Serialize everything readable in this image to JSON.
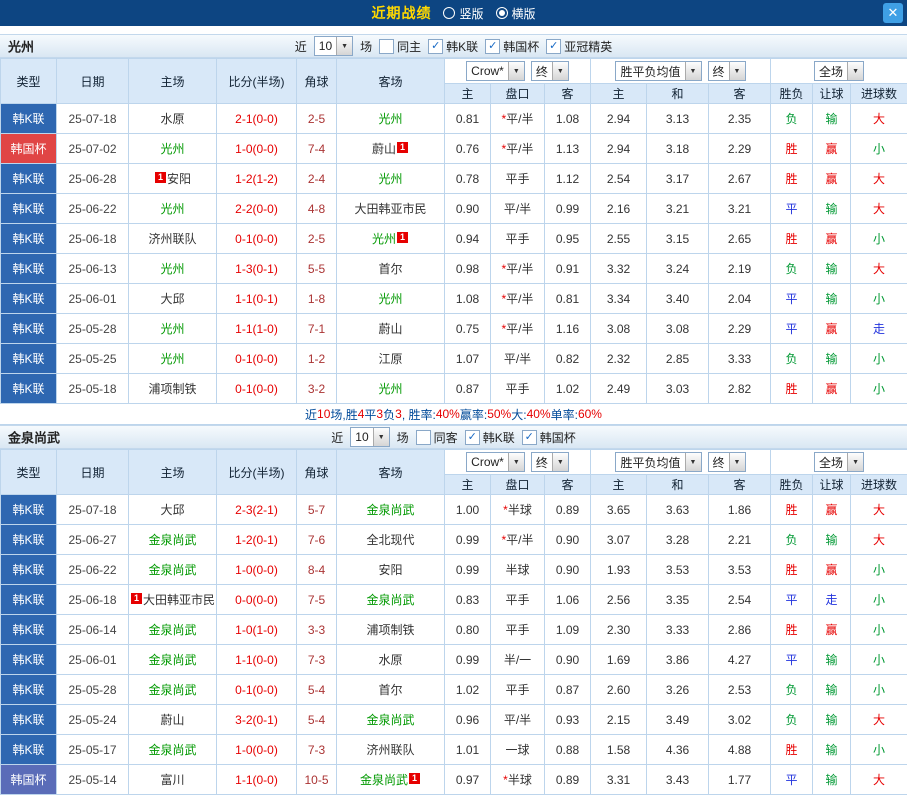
{
  "topbar": {
    "title": "近期战绩",
    "layout_options": [
      {
        "label": "竖版",
        "selected": false
      },
      {
        "label": "横版",
        "selected": true
      }
    ],
    "close_label": "✕"
  },
  "table": {
    "headers": {
      "left": [
        "类型",
        "日期",
        "主场",
        "比分(半场)",
        "角球",
        "客场"
      ],
      "odds_select": "Crow*",
      "odds_stage_select": "终",
      "avg_select": "胜平负均值",
      "avg_stage_select": "终",
      "scope_select": "全场",
      "odds_sub": [
        "主",
        "盘口",
        "客"
      ],
      "avg_sub": [
        "主",
        "和",
        "客"
      ],
      "result_sub": [
        "胜负",
        "让球",
        "进球数"
      ]
    }
  },
  "colors": {
    "topbar_bg": "#0d4582",
    "title": "#ffd800",
    "close_bg": "#3fa0e6",
    "header_bg": "#d8e8f8",
    "grid_border": "#bdd5ec",
    "team_green": "#009900",
    "score_red": "#e60000",
    "corner": "#aa3333",
    "summary_base": "#004a99",
    "summary_red": "#e60000",
    "handicap_star": "#e60000",
    "type_palette": {
      "league_blue": "#2e67b1",
      "cup_red": "#e04545",
      "cup_indigo": "#5a6cb8"
    },
    "outcome": {
      "red": "#e60000",
      "green": "#009933",
      "blue": "#2233dd"
    }
  },
  "sections": [
    {
      "team": "光州",
      "filter": {
        "near_label": "近",
        "count": "10",
        "games_label": "场",
        "same": {
          "label": "同主",
          "checked": false
        },
        "leagues": [
          {
            "label": "韩K联",
            "checked": true
          },
          {
            "label": "韩国杯",
            "checked": true
          },
          {
            "label": "亚冠精英",
            "checked": true
          }
        ]
      },
      "rows": [
        {
          "type": "韩K联",
          "type_style": "league_blue",
          "date": "25-07-18",
          "home": {
            "n": "水原",
            "hl": false
          },
          "score": "2-1(0-0)",
          "corner": "2-5",
          "away": {
            "n": "光州",
            "hl": true
          },
          "odds": [
            "0.81",
            "*平/半",
            "1.08"
          ],
          "avg": [
            "2.94",
            "3.13",
            "2.35"
          ],
          "result": [
            {
              "t": "负",
              "c": "green"
            },
            {
              "t": "输",
              "c": "green"
            },
            {
              "t": "大",
              "c": "red"
            }
          ]
        },
        {
          "type": "韩国杯",
          "type_style": "cup_red",
          "date": "25-07-02",
          "home": {
            "n": "光州",
            "hl": true
          },
          "score": "1-0(0-0)",
          "corner": "7-4",
          "away": {
            "n": "蔚山",
            "hl": false,
            "badge": "1",
            "badge_side": "right"
          },
          "odds": [
            "0.76",
            "*平/半",
            "1.13"
          ],
          "avg": [
            "2.94",
            "3.18",
            "2.29"
          ],
          "result": [
            {
              "t": "胜",
              "c": "red"
            },
            {
              "t": "赢",
              "c": "red"
            },
            {
              "t": "小",
              "c": "green"
            }
          ]
        },
        {
          "type": "韩K联",
          "type_style": "league_blue",
          "date": "25-06-28",
          "home": {
            "n": "安阳",
            "hl": false,
            "badge": "1",
            "badge_side": "left"
          },
          "score": "1-2(1-2)",
          "corner": "2-4",
          "away": {
            "n": "光州",
            "hl": true
          },
          "odds": [
            "0.78",
            "平手",
            "1.12"
          ],
          "avg": [
            "2.54",
            "3.17",
            "2.67"
          ],
          "result": [
            {
              "t": "胜",
              "c": "red"
            },
            {
              "t": "赢",
              "c": "red"
            },
            {
              "t": "大",
              "c": "red"
            }
          ]
        },
        {
          "type": "韩K联",
          "type_style": "league_blue",
          "date": "25-06-22",
          "home": {
            "n": "光州",
            "hl": true
          },
          "score": "2-2(0-0)",
          "corner": "4-8",
          "away": {
            "n": "大田韩亚市民",
            "hl": false
          },
          "odds": [
            "0.90",
            "平/半",
            "0.99"
          ],
          "avg": [
            "2.16",
            "3.21",
            "3.21"
          ],
          "result": [
            {
              "t": "平",
              "c": "blue"
            },
            {
              "t": "输",
              "c": "green"
            },
            {
              "t": "大",
              "c": "red"
            }
          ]
        },
        {
          "type": "韩K联",
          "type_style": "league_blue",
          "date": "25-06-18",
          "home": {
            "n": "济州联队",
            "hl": false
          },
          "score": "0-1(0-0)",
          "corner": "2-5",
          "away": {
            "n": "光州",
            "hl": true,
            "badge": "1",
            "badge_side": "right"
          },
          "odds": [
            "0.94",
            "平手",
            "0.95"
          ],
          "avg": [
            "2.55",
            "3.15",
            "2.65"
          ],
          "result": [
            {
              "t": "胜",
              "c": "red"
            },
            {
              "t": "赢",
              "c": "red"
            },
            {
              "t": "小",
              "c": "green"
            }
          ]
        },
        {
          "type": "韩K联",
          "type_style": "league_blue",
          "date": "25-06-13",
          "home": {
            "n": "光州",
            "hl": true
          },
          "score": "1-3(0-1)",
          "corner": "5-5",
          "away": {
            "n": "首尔",
            "hl": false
          },
          "odds": [
            "0.98",
            "*平/半",
            "0.91"
          ],
          "avg": [
            "3.32",
            "3.24",
            "2.19"
          ],
          "result": [
            {
              "t": "负",
              "c": "green"
            },
            {
              "t": "输",
              "c": "green"
            },
            {
              "t": "大",
              "c": "red"
            }
          ]
        },
        {
          "type": "韩K联",
          "type_style": "league_blue",
          "date": "25-06-01",
          "home": {
            "n": "大邱",
            "hl": false
          },
          "score": "1-1(0-1)",
          "corner": "1-8",
          "away": {
            "n": "光州",
            "hl": true
          },
          "odds": [
            "1.08",
            "*平/半",
            "0.81"
          ],
          "avg": [
            "3.34",
            "3.40",
            "2.04"
          ],
          "result": [
            {
              "t": "平",
              "c": "blue"
            },
            {
              "t": "输",
              "c": "green"
            },
            {
              "t": "小",
              "c": "green"
            }
          ]
        },
        {
          "type": "韩K联",
          "type_style": "league_blue",
          "date": "25-05-28",
          "home": {
            "n": "光州",
            "hl": true
          },
          "score": "1-1(1-0)",
          "corner": "7-1",
          "away": {
            "n": "蔚山",
            "hl": false
          },
          "odds": [
            "0.75",
            "*平/半",
            "1.16"
          ],
          "avg": [
            "3.08",
            "3.08",
            "2.29"
          ],
          "result": [
            {
              "t": "平",
              "c": "blue"
            },
            {
              "t": "赢",
              "c": "red"
            },
            {
              "t": "走",
              "c": "blue"
            }
          ]
        },
        {
          "type": "韩K联",
          "type_style": "league_blue",
          "date": "25-05-25",
          "home": {
            "n": "光州",
            "hl": true
          },
          "score": "0-1(0-0)",
          "corner": "1-2",
          "away": {
            "n": "江原",
            "hl": false
          },
          "odds": [
            "1.07",
            "平/半",
            "0.82"
          ],
          "avg": [
            "2.32",
            "2.85",
            "3.33"
          ],
          "result": [
            {
              "t": "负",
              "c": "green"
            },
            {
              "t": "输",
              "c": "green"
            },
            {
              "t": "小",
              "c": "green"
            }
          ]
        },
        {
          "type": "韩K联",
          "type_style": "league_blue",
          "date": "25-05-18",
          "home": {
            "n": "浦项制铁",
            "hl": false
          },
          "score": "0-1(0-0)",
          "corner": "3-2",
          "away": {
            "n": "光州",
            "hl": true
          },
          "odds": [
            "0.87",
            "平手",
            "1.02"
          ],
          "avg": [
            "2.49",
            "3.03",
            "2.82"
          ],
          "result": [
            {
              "t": "胜",
              "c": "red"
            },
            {
              "t": "赢",
              "c": "red"
            },
            {
              "t": "小",
              "c": "green"
            }
          ]
        }
      ],
      "summary": [
        {
          "t": "近",
          "red": false
        },
        {
          "t": "10",
          "red": true
        },
        {
          "t": "场,胜",
          "red": false
        },
        {
          "t": "4",
          "red": true
        },
        {
          "t": "平",
          "red": false
        },
        {
          "t": "3",
          "red": true
        },
        {
          "t": "负",
          "red": false
        },
        {
          "t": "3",
          "red": true
        },
        {
          "t": ", 胜率:",
          "red": false
        },
        {
          "t": "40%",
          "red": true
        },
        {
          "t": " 赢率:",
          "red": false
        },
        {
          "t": "50%",
          "red": true
        },
        {
          "t": " 大:",
          "red": false
        },
        {
          "t": "40%",
          "red": true
        },
        {
          "t": " 单率:",
          "red": false
        },
        {
          "t": "60%",
          "red": true
        }
      ]
    },
    {
      "team": "金泉尚武",
      "filter": {
        "near_label": "近",
        "count": "10",
        "games_label": "场",
        "same": {
          "label": "同客",
          "checked": false
        },
        "leagues": [
          {
            "label": "韩K联",
            "checked": true
          },
          {
            "label": "韩国杯",
            "checked": true
          }
        ]
      },
      "rows": [
        {
          "type": "韩K联",
          "type_style": "league_blue",
          "date": "25-07-18",
          "home": {
            "n": "大邱",
            "hl": false
          },
          "score": "2-3(2-1)",
          "corner": "5-7",
          "away": {
            "n": "金泉尚武",
            "hl": true
          },
          "odds": [
            "1.00",
            "*半球",
            "0.89"
          ],
          "avg": [
            "3.65",
            "3.63",
            "1.86"
          ],
          "result": [
            {
              "t": "胜",
              "c": "red"
            },
            {
              "t": "赢",
              "c": "red"
            },
            {
              "t": "大",
              "c": "red"
            }
          ]
        },
        {
          "type": "韩K联",
          "type_style": "league_blue",
          "date": "25-06-27",
          "home": {
            "n": "金泉尚武",
            "hl": true
          },
          "score": "1-2(0-1)",
          "corner": "7-6",
          "away": {
            "n": "全北现代",
            "hl": false
          },
          "odds": [
            "0.99",
            "*平/半",
            "0.90"
          ],
          "avg": [
            "3.07",
            "3.28",
            "2.21"
          ],
          "result": [
            {
              "t": "负",
              "c": "green"
            },
            {
              "t": "输",
              "c": "green"
            },
            {
              "t": "大",
              "c": "red"
            }
          ]
        },
        {
          "type": "韩K联",
          "type_style": "league_blue",
          "date": "25-06-22",
          "home": {
            "n": "金泉尚武",
            "hl": true
          },
          "score": "1-0(0-0)",
          "corner": "8-4",
          "away": {
            "n": "安阳",
            "hl": false
          },
          "odds": [
            "0.99",
            "半球",
            "0.90"
          ],
          "avg": [
            "1.93",
            "3.53",
            "3.53"
          ],
          "result": [
            {
              "t": "胜",
              "c": "red"
            },
            {
              "t": "赢",
              "c": "red"
            },
            {
              "t": "小",
              "c": "green"
            }
          ]
        },
        {
          "type": "韩K联",
          "type_style": "league_blue",
          "date": "25-06-18",
          "home": {
            "n": "大田韩亚市民",
            "hl": false,
            "badge": "1",
            "badge_side": "left"
          },
          "score": "0-0(0-0)",
          "corner": "7-5",
          "away": {
            "n": "金泉尚武",
            "hl": true
          },
          "odds": [
            "0.83",
            "平手",
            "1.06"
          ],
          "avg": [
            "2.56",
            "3.35",
            "2.54"
          ],
          "result": [
            {
              "t": "平",
              "c": "blue"
            },
            {
              "t": "走",
              "c": "blue"
            },
            {
              "t": "小",
              "c": "green"
            }
          ]
        },
        {
          "type": "韩K联",
          "type_style": "league_blue",
          "date": "25-06-14",
          "home": {
            "n": "金泉尚武",
            "hl": true
          },
          "score": "1-0(1-0)",
          "corner": "3-3",
          "away": {
            "n": "浦项制铁",
            "hl": false
          },
          "odds": [
            "0.80",
            "平手",
            "1.09"
          ],
          "avg": [
            "2.30",
            "3.33",
            "2.86"
          ],
          "result": [
            {
              "t": "胜",
              "c": "red"
            },
            {
              "t": "赢",
              "c": "red"
            },
            {
              "t": "小",
              "c": "green"
            }
          ]
        },
        {
          "type": "韩K联",
          "type_style": "league_blue",
          "date": "25-06-01",
          "home": {
            "n": "金泉尚武",
            "hl": true
          },
          "score": "1-1(0-0)",
          "corner": "7-3",
          "away": {
            "n": "水原",
            "hl": false
          },
          "odds": [
            "0.99",
            "半/一",
            "0.90"
          ],
          "avg": [
            "1.69",
            "3.86",
            "4.27"
          ],
          "result": [
            {
              "t": "平",
              "c": "blue"
            },
            {
              "t": "输",
              "c": "green"
            },
            {
              "t": "小",
              "c": "green"
            }
          ]
        },
        {
          "type": "韩K联",
          "type_style": "league_blue",
          "date": "25-05-28",
          "home": {
            "n": "金泉尚武",
            "hl": true
          },
          "score": "0-1(0-0)",
          "corner": "5-4",
          "away": {
            "n": "首尔",
            "hl": false
          },
          "odds": [
            "1.02",
            "平手",
            "0.87"
          ],
          "avg": [
            "2.60",
            "3.26",
            "2.53"
          ],
          "result": [
            {
              "t": "负",
              "c": "green"
            },
            {
              "t": "输",
              "c": "green"
            },
            {
              "t": "小",
              "c": "green"
            }
          ]
        },
        {
          "type": "韩K联",
          "type_style": "league_blue",
          "date": "25-05-24",
          "home": {
            "n": "蔚山",
            "hl": false
          },
          "score": "3-2(0-1)",
          "corner": "5-4",
          "away": {
            "n": "金泉尚武",
            "hl": true
          },
          "odds": [
            "0.96",
            "平/半",
            "0.93"
          ],
          "avg": [
            "2.15",
            "3.49",
            "3.02"
          ],
          "result": [
            {
              "t": "负",
              "c": "green"
            },
            {
              "t": "输",
              "c": "green"
            },
            {
              "t": "大",
              "c": "red"
            }
          ]
        },
        {
          "type": "韩K联",
          "type_style": "league_blue",
          "date": "25-05-17",
          "home": {
            "n": "金泉尚武",
            "hl": true
          },
          "score": "1-0(0-0)",
          "corner": "7-3",
          "away": {
            "n": "济州联队",
            "hl": false
          },
          "odds": [
            "1.01",
            "一球",
            "0.88"
          ],
          "avg": [
            "1.58",
            "4.36",
            "4.88"
          ],
          "result": [
            {
              "t": "胜",
              "c": "red"
            },
            {
              "t": "输",
              "c": "green"
            },
            {
              "t": "小",
              "c": "green"
            }
          ]
        },
        {
          "type": "韩国杯",
          "type_style": "cup_indigo",
          "date": "25-05-14",
          "home": {
            "n": "富川",
            "hl": false
          },
          "score": "1-1(0-0)",
          "corner": "10-5",
          "away": {
            "n": "金泉尚武",
            "hl": true,
            "badge": "1",
            "badge_side": "right"
          },
          "odds": [
            "0.97",
            "*半球",
            "0.89"
          ],
          "avg": [
            "3.31",
            "3.43",
            "1.77"
          ],
          "result": [
            {
              "t": "平",
              "c": "blue"
            },
            {
              "t": "输",
              "c": "green"
            },
            {
              "t": "大",
              "c": "red"
            }
          ]
        }
      ],
      "summary": null
    }
  ]
}
